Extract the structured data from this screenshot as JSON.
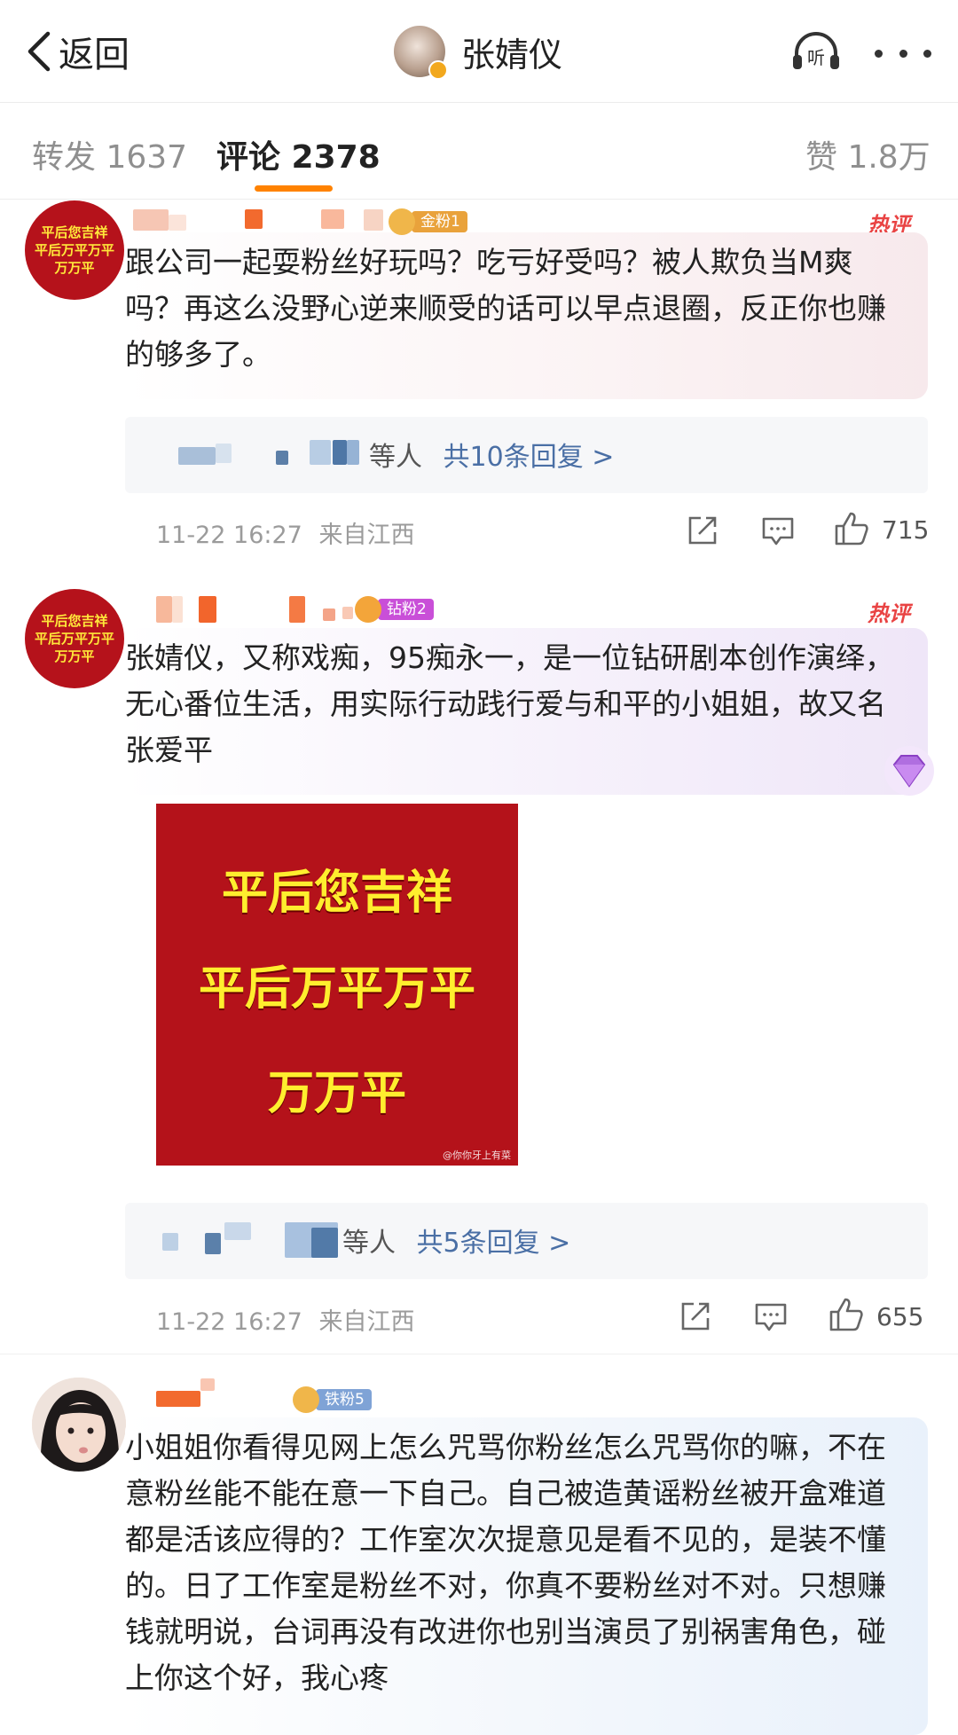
{
  "nav": {
    "back_label": "返回",
    "title": "张婧仪",
    "listen_label": "听"
  },
  "tabs": {
    "repost": "转发 1637",
    "comments": "评论 2378",
    "likes": "赞 1.8万"
  },
  "comments": [
    {
      "avatar_lines": [
        "平后您吉祥",
        "平后万平万平",
        "万万平"
      ],
      "badge": "金粉1",
      "hot_label": "热评",
      "text": "跟公司一起耍粉丝好玩吗？吃亏好受吗？被人欺负当M爽吗？再这么没野心逆来顺受的话可以早点退圈，反正你也赚的够多了。",
      "reply_prefix": "等人",
      "reply_link": "共10条回复 >",
      "time": "11-22 16:27",
      "location": "来自江西",
      "likes": "715"
    },
    {
      "avatar_lines": [
        "平后您吉祥",
        "平后万平万平",
        "万万平"
      ],
      "badge": "钻粉2",
      "hot_label": "热评",
      "text": "张婧仪，又称戏痴，95痴永一，是一位钻研剧本创作演绎，无心番位生活，用实际行动践行爱与和平的小姐姐，故又名张爱平",
      "image_lines": [
        "平后您吉祥",
        "平后万平万平",
        "万万平"
      ],
      "image_watermark": "@你你牙上有菜",
      "reply_prefix": "等人",
      "reply_link": "共5条回复 >",
      "time": "11-22 16:27",
      "location": "来自江西",
      "likes": "655"
    },
    {
      "badge": "铁粉5",
      "text": "小姐姐你看得见网上怎么咒骂你粉丝怎么咒骂你的嘛，不在意粉丝能不能在意一下自己。自己被造黄谣粉丝被开盒难道都是活该应得的？工作室次次提意见是看不见的，是装不懂的。日了工作室是粉丝不对，你真不要粉丝对不对。只想赚钱就明说，台词再没有改进你也别当演员了别祸害角色，碰上你这个好，我心疼"
    }
  ],
  "colors": {
    "accent_orange": "#ff8200",
    "hot_red": "#e94343",
    "link_blue": "#4a6fa5",
    "badge_gold": "#e9a23b",
    "badge_diamond": "#c94fd8",
    "badge_iron": "#7fa3d6"
  },
  "icons": [
    "back-chevron-icon",
    "listen-headphone-icon",
    "more-dots-icon",
    "share-icon",
    "reply-icon",
    "like-icon",
    "diamond-gem-icon"
  ]
}
